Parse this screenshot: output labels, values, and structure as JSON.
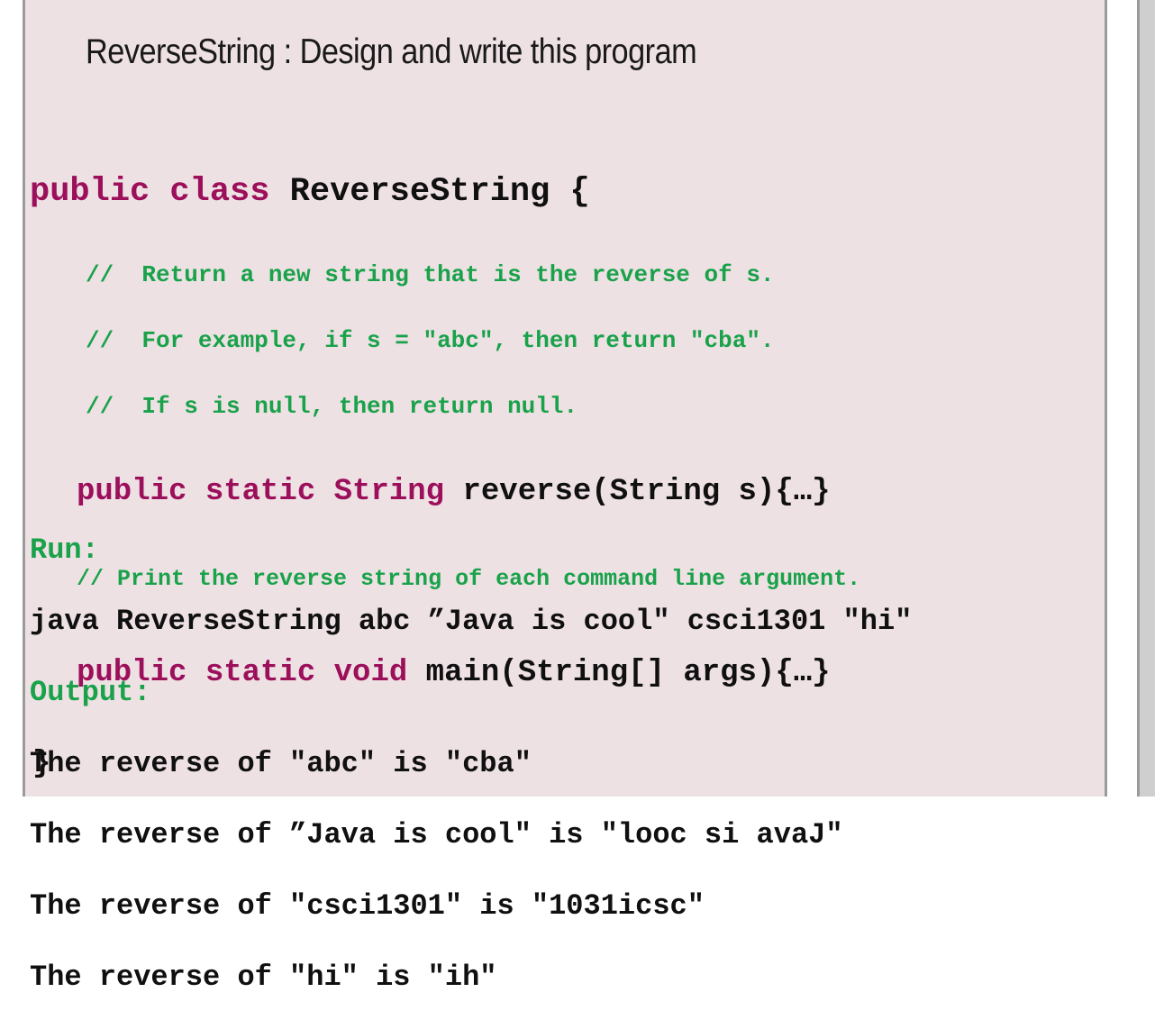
{
  "slide": {
    "title": "ReverseString : Design and write this program",
    "background_color": "#eee1e4",
    "border_color": "#9b9b9b"
  },
  "colors": {
    "keyword": "#9c0f5b",
    "identifier": "#101010",
    "comment": "#19a24a",
    "slide_background": "#eee1e4",
    "page_background": "#ffffff",
    "desktop": "#cfcfcf"
  },
  "code": {
    "class_line": {
      "keyword": "public class ",
      "identifier": "ReverseString {"
    },
    "comments_top": [
      "//  Return a new string that is the reverse of s.",
      "//  For example, if s = \"abc\", then return \"cba\".",
      "//  If s is null, then return null."
    ],
    "reverse_signature": {
      "keyword": "public static String ",
      "identifier": "reverse(String s){…}"
    },
    "comment_main": "// Print the reverse string of each command line argument.",
    "main_signature": {
      "keyword": "public static void ",
      "identifier": "main(String[] args){…}"
    },
    "close_brace": "}"
  },
  "run": {
    "run_label": "Run:",
    "command": "java ReverseString abc ”Java is cool\" csci1301 \"hi\"",
    "output_label": "Output:",
    "output_lines": [
      "The reverse of \"abc\" is \"cba\"",
      "The reverse of ”Java is cool\" is \"looc si avaJ\"",
      "The reverse of \"csci1301\" is \"1031icsc\"",
      "The reverse of \"hi\" is \"ih\""
    ]
  }
}
